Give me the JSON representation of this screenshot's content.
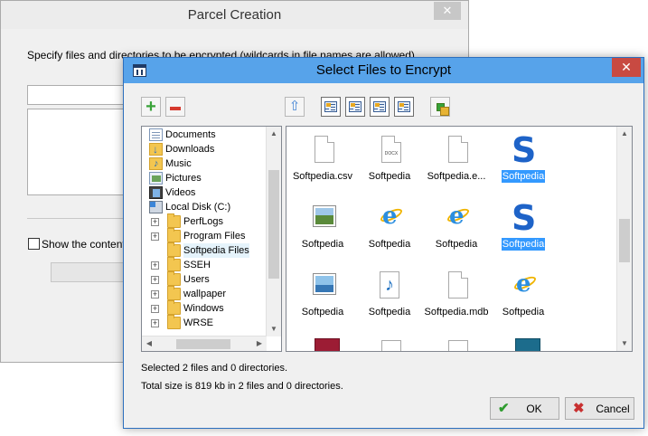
{
  "background_window": {
    "title": "Parcel Creation",
    "close_glyph": "✕",
    "instructions": "Specify files and directories to be encrypted (wildcards in file names are allowed).",
    "show_contents_label": "Show the contents"
  },
  "dialog": {
    "title": "Select Files to Encrypt",
    "close_glyph": "✕",
    "toolbar": {
      "add_glyph": "+",
      "up_glyph": "⇧"
    },
    "tree": [
      {
        "label": "Documents",
        "icon": "documents-icon",
        "indent": 0,
        "expander": ""
      },
      {
        "label": "Downloads",
        "icon": "downloads-icon",
        "indent": 0,
        "expander": ""
      },
      {
        "label": "Music",
        "icon": "music-icon",
        "indent": 0,
        "expander": ""
      },
      {
        "label": "Pictures",
        "icon": "pictures-icon",
        "indent": 0,
        "expander": ""
      },
      {
        "label": "Videos",
        "icon": "videos-icon",
        "indent": 0,
        "expander": ""
      },
      {
        "label": "Local Disk (C:)",
        "icon": "disk-icon",
        "indent": 0,
        "expander": ""
      },
      {
        "label": "PerfLogs",
        "icon": "folder-icon",
        "indent": 1,
        "expander": "+"
      },
      {
        "label": "Program Files",
        "icon": "folder-icon",
        "indent": 1,
        "expander": "+"
      },
      {
        "label": "Softpedia Files",
        "icon": "folder-icon",
        "indent": 1,
        "expander": "",
        "selected": true
      },
      {
        "label": "SSEH",
        "icon": "folder-icon",
        "indent": 1,
        "expander": "+"
      },
      {
        "label": "Users",
        "icon": "folder-icon",
        "indent": 1,
        "expander": "+"
      },
      {
        "label": "wallpaper",
        "icon": "folder-icon",
        "indent": 1,
        "expander": "+"
      },
      {
        "label": "Windows",
        "icon": "folder-icon",
        "indent": 1,
        "expander": "+"
      },
      {
        "label": "WRSE",
        "icon": "folder-icon",
        "indent": 1,
        "expander": "+"
      }
    ],
    "files": [
      {
        "name": "Softpedia.csv",
        "icon": "document-icon",
        "selected": false
      },
      {
        "name": "Softpedia",
        "icon": "docx-document-icon",
        "tag": "DOCX",
        "selected": false
      },
      {
        "name": "Softpedia.e...",
        "icon": "document-icon",
        "selected": false
      },
      {
        "name": "Softpedia",
        "icon": "softpedia-logo-icon",
        "selected": true
      },
      {
        "name": "Softpedia",
        "icon": "picture-icon",
        "selected": false
      },
      {
        "name": "Softpedia",
        "icon": "internet-explorer-icon",
        "selected": false
      },
      {
        "name": "Softpedia",
        "icon": "internet-explorer-icon",
        "selected": false
      },
      {
        "name": "Softpedia",
        "icon": "softpedia-logo-icon",
        "selected": true
      },
      {
        "name": "Softpedia",
        "icon": "landscape-picture-icon",
        "selected": false
      },
      {
        "name": "Softpedia",
        "icon": "audio-file-icon",
        "selected": false
      },
      {
        "name": "Softpedia.mdb",
        "icon": "document-icon",
        "selected": false
      },
      {
        "name": "Softpedia",
        "icon": "internet-explorer-icon",
        "selected": false
      }
    ],
    "status": {
      "selected": "Selected 2 files and 0 directories.",
      "total": "Total size is 819 kb in 2 files and 0 directories."
    },
    "buttons": {
      "ok_label": "OK",
      "ok_glyph": "✔",
      "cancel_label": "Cancel",
      "cancel_glyph": "✖"
    },
    "colors": {
      "titlebar": "#57a3ea",
      "close_button": "#c84a42",
      "selection": "#3399ff",
      "ok_check": "#2e9b2e",
      "cancel_x": "#c83030"
    }
  }
}
